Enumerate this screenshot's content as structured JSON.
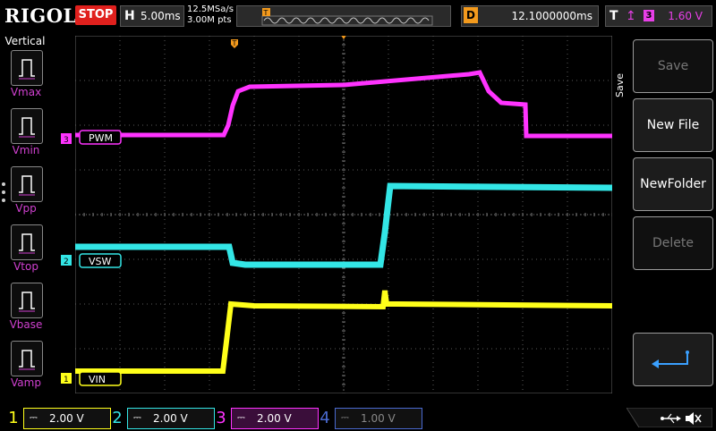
{
  "brand": "RIGOL",
  "run_state": "STOP",
  "horizontal": {
    "letter": "H",
    "timebase": "5.00ms",
    "sample_rate": "12.5MSa/s",
    "memory_depth": "3.00M pts"
  },
  "delay": {
    "letter": "D",
    "value": "12.1000000ms"
  },
  "trigger": {
    "letter": "T",
    "source_channel": "3",
    "level": "1.60 V",
    "marker": "T"
  },
  "measurements": {
    "title": "Vertical",
    "items": [
      {
        "label": "Vmax",
        "icon": "vmax-icon"
      },
      {
        "label": "Vmin",
        "icon": "vmin-icon"
      },
      {
        "label": "Vpp",
        "icon": "vpp-icon"
      },
      {
        "label": "Vtop",
        "icon": "vtop-icon"
      },
      {
        "label": "Vbase",
        "icon": "vbase-icon"
      },
      {
        "label": "Vamp",
        "icon": "vamp-icon"
      }
    ]
  },
  "menu": {
    "title": "Save",
    "items": [
      {
        "label": "Save",
        "enabled": false
      },
      {
        "label": "New File",
        "enabled": true
      },
      {
        "label": "NewFolder",
        "enabled": true
      },
      {
        "label": "Delete",
        "enabled": false
      }
    ],
    "back_icon": "return-arrow-icon"
  },
  "traces": [
    {
      "channel": "3",
      "label": "PWM",
      "color": "#ff33ff"
    },
    {
      "channel": "2",
      "label": "VSW",
      "color": "#33e6e6"
    },
    {
      "channel": "1",
      "label": "VIN",
      "color": "#ffff1a"
    }
  ],
  "channels": [
    {
      "num": "1",
      "scale": "2.00 V",
      "color": "#ffff1a",
      "active": true
    },
    {
      "num": "2",
      "scale": "2.00 V",
      "color": "#33e6e6",
      "active": true
    },
    {
      "num": "3",
      "scale": "2.00 V",
      "color": "#ff33ff",
      "active": true
    },
    {
      "num": "4",
      "scale": "1.00 V",
      "color": "#4a6ad0",
      "active": false
    }
  ],
  "status_icons": [
    "usb-icon",
    "speaker-muted-icon"
  ]
}
